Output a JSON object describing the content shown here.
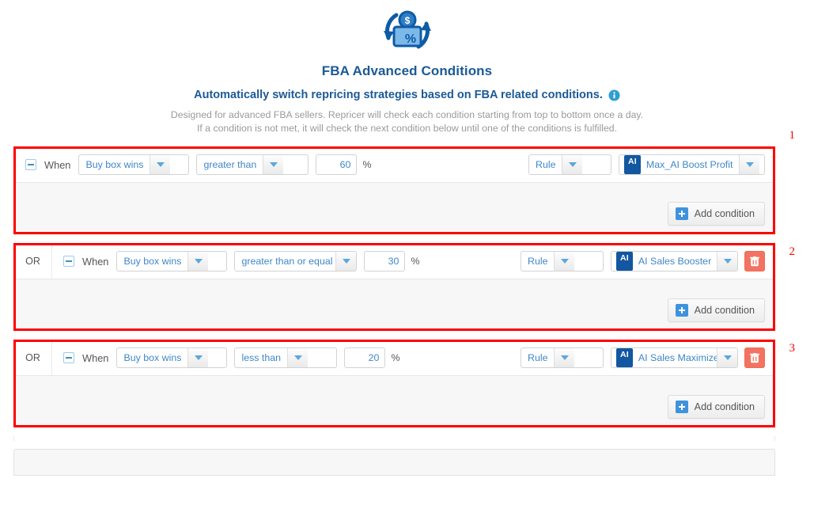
{
  "header": {
    "icon_name": "fba-repricing-icon",
    "title": "FBA Advanced Conditions",
    "subtitle": "Automatically switch repricing strategies based on FBA related conditions.",
    "info_icon": "info-icon",
    "description_line1": "Designed for advanced FBA sellers. Repricer will check each condition starting from top to bottom once a day.",
    "description_line2": "If a condition is not met, it will check the next condition below until one of the conditions is fulfilled."
  },
  "labels": {
    "when": "When",
    "or": "OR",
    "percent": "%",
    "ai_badge": "AI",
    "add_condition": "Add condition"
  },
  "conditions": [
    {
      "annotation": "1",
      "operator_prefix": "",
      "metric": "Buy box wins",
      "comparator": "greater than",
      "value": "60",
      "unit": "%",
      "action_type": "Rule",
      "strategy": "Max_AI Boost Profit",
      "has_delete": false,
      "add_label": "Add condition"
    },
    {
      "annotation": "2",
      "operator_prefix": "OR",
      "metric": "Buy box wins",
      "comparator": "greater than or equal to",
      "value": "30",
      "unit": "%",
      "action_type": "Rule",
      "strategy": "AI Sales Booster",
      "has_delete": true,
      "add_label": "Add condition"
    },
    {
      "annotation": "3",
      "operator_prefix": "OR",
      "metric": "Buy box wins",
      "comparator": "less than",
      "value": "20",
      "unit": "%",
      "action_type": "Rule",
      "strategy": "AI Sales Maximizer...",
      "has_delete": true,
      "add_label": "Add condition"
    }
  ],
  "colors": {
    "brand_blue": "#1b5a96",
    "link_blue": "#3f87c9",
    "ai_badge_blue": "#1257a0",
    "annotation_red": "#fd0000",
    "delete_red": "#f37362",
    "muted_text": "#9a9a9a"
  }
}
